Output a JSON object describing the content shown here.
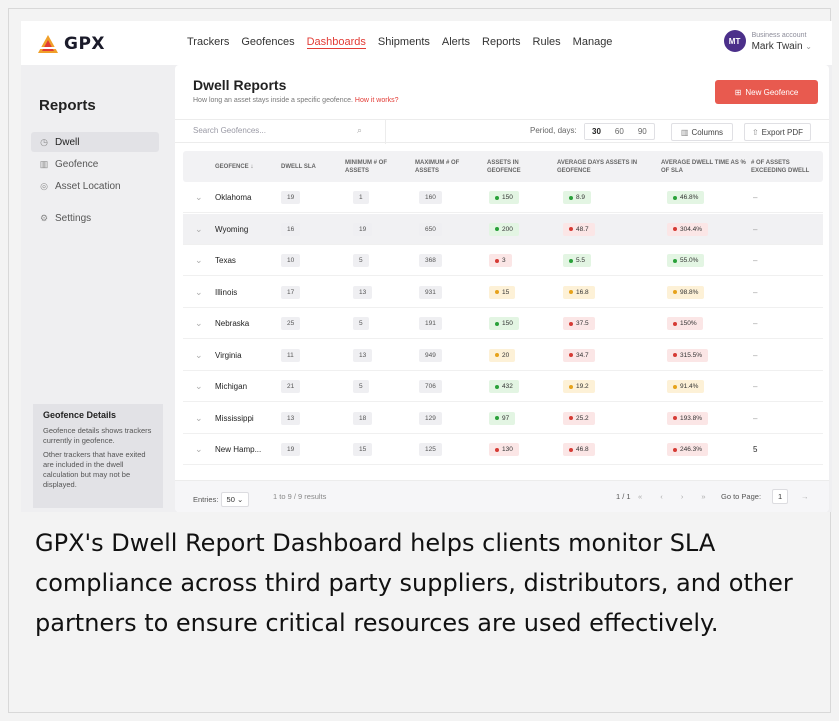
{
  "app": {
    "brand": "GPX",
    "brand_color": "#e23b35"
  },
  "nav": {
    "items": [
      "Trackers",
      "Geofences",
      "Dashboards",
      "Shipments",
      "Alerts",
      "Reports",
      "Rules",
      "Manage"
    ],
    "active": "Dashboards"
  },
  "account": {
    "initials": "MT",
    "label": "Business account",
    "name": "Mark Twain"
  },
  "sidebar": {
    "title": "Reports",
    "items": [
      {
        "label": "Dwell",
        "icon": "clock-icon"
      },
      {
        "label": "Geofence",
        "icon": "map-icon"
      },
      {
        "label": "Asset Location",
        "icon": "pin-icon"
      },
      {
        "label": "Settings",
        "icon": "gear-icon"
      }
    ],
    "details": {
      "title": "Geofence Details",
      "p1": "Geofence details shows trackers currently in geofence.",
      "p2": "Other trackers that have exited are included in the dwell calculation but may not be displayed."
    }
  },
  "main": {
    "title": "Dwell Reports",
    "subtitle": "How long an asset stays inside a specific geofence.",
    "subtitle_link": "How it works?",
    "new_button": "New Geofence",
    "search_placeholder": "Search Geofences...",
    "period_label": "Period, days:",
    "periods": [
      "30",
      "60",
      "90"
    ],
    "columns_button": "Columns",
    "export_button": "Export PDF"
  },
  "table": {
    "headers": [
      "GEOFENCE ↓",
      "DWELL SLA",
      "MINIMUM # OF ASSETS",
      "MAXIMUM # OF ASSETS",
      "ASSETS IN GEOFENCE",
      "AVERAGE DAYS ASSETS IN GEOFENCE",
      "AVERAGE DWELL TIME AS % OF SLA",
      "# OF ASSETS EXCEEDING DWELL"
    ],
    "rows": [
      {
        "name": "Oklahoma",
        "sla": "19",
        "min": "1",
        "max": "160",
        "assets": "150",
        "assets_c": "g",
        "days": "8.9",
        "days_c": "g",
        "pct": "46.8%",
        "pct_c": "g",
        "exceed": "–"
      },
      {
        "name": "Wyoming",
        "sla": "16",
        "min": "19",
        "max": "650",
        "assets": "200",
        "assets_c": "g",
        "days": "48.7",
        "days_c": "r",
        "pct": "304.4%",
        "pct_c": "r",
        "exceed": "–"
      },
      {
        "name": "Texas",
        "sla": "10",
        "min": "5",
        "max": "368",
        "assets": "3",
        "assets_c": "r",
        "days": "5.5",
        "days_c": "g",
        "pct": "55.0%",
        "pct_c": "g",
        "exceed": "–"
      },
      {
        "name": "Illinois",
        "sla": "17",
        "min": "13",
        "max": "931",
        "assets": "15",
        "assets_c": "y",
        "days": "16.8",
        "days_c": "y",
        "pct": "98.8%",
        "pct_c": "y",
        "exceed": "–"
      },
      {
        "name": "Nebraska",
        "sla": "25",
        "min": "5",
        "max": "191",
        "assets": "150",
        "assets_c": "g",
        "days": "37.5",
        "days_c": "r",
        "pct": "150%",
        "pct_c": "r",
        "exceed": "–"
      },
      {
        "name": "Virginia",
        "sla": "11",
        "min": "13",
        "max": "949",
        "assets": "20",
        "assets_c": "y",
        "days": "34.7",
        "days_c": "r",
        "pct": "315.5%",
        "pct_c": "r",
        "exceed": "–"
      },
      {
        "name": "Michigan",
        "sla": "21",
        "min": "5",
        "max": "706",
        "assets": "432",
        "assets_c": "g",
        "days": "19.2",
        "days_c": "y",
        "pct": "91.4%",
        "pct_c": "y",
        "exceed": "–"
      },
      {
        "name": "Mississippi",
        "sla": "13",
        "min": "18",
        "max": "129",
        "assets": "97",
        "assets_c": "g",
        "days": "25.2",
        "days_c": "r",
        "pct": "193.8%",
        "pct_c": "r",
        "exceed": "–"
      },
      {
        "name": "New Hamp...",
        "sla": "19",
        "min": "15",
        "max": "125",
        "assets": "130",
        "assets_c": "r",
        "days": "46.8",
        "days_c": "r",
        "pct": "246.3%",
        "pct_c": "r",
        "exceed": "5"
      }
    ]
  },
  "footer": {
    "entries_label": "Entries:",
    "entries_value": "50",
    "results": "1 to 9 / 9 results",
    "page_info": "1 / 1",
    "goto_label": "Go to Page:",
    "goto_value": "1"
  },
  "caption": "GPX's Dwell Report Dashboard helps clients monitor SLA compliance across third party suppliers, distributors, and other partners to ensure critical resources are used effectively."
}
